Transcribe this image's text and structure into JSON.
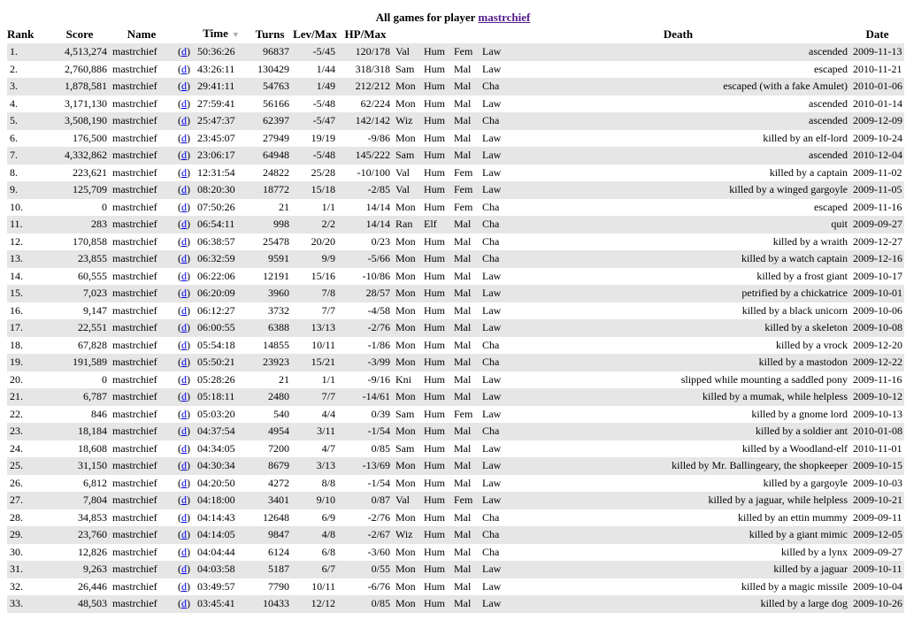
{
  "caption": {
    "prefix": "All games for player",
    "player_link": "mastrchief"
  },
  "sort_arrow": "▼",
  "columns": [
    "Rank",
    "Score",
    "Name",
    "",
    "Time",
    "Turns",
    "Lev/Max",
    "HP/Max",
    "",
    "",
    "",
    "",
    "Death",
    "Date"
  ],
  "dump_label": "d",
  "rows": [
    [
      "1.",
      "4,513,274",
      "mastrchief",
      "50:36:26",
      "96837",
      "-5/45",
      "120/178",
      "Val",
      "Hum",
      "Fem",
      "Law",
      "ascended",
      "2009-11-13"
    ],
    [
      "2.",
      "2,760,886",
      "mastrchief",
      "43:26:11",
      "130429",
      "1/44",
      "318/318",
      "Sam",
      "Hum",
      "Mal",
      "Law",
      "escaped",
      "2010-11-21"
    ],
    [
      "3.",
      "1,878,581",
      "mastrchief",
      "29:41:11",
      "54763",
      "1/49",
      "212/212",
      "Mon",
      "Hum",
      "Mal",
      "Cha",
      "escaped (with a fake Amulet)",
      "2010-01-06"
    ],
    [
      "4.",
      "3,171,130",
      "mastrchief",
      "27:59:41",
      "56166",
      "-5/48",
      "62/224",
      "Mon",
      "Hum",
      "Mal",
      "Law",
      "ascended",
      "2010-01-14"
    ],
    [
      "5.",
      "3,508,190",
      "mastrchief",
      "25:47:37",
      "62397",
      "-5/47",
      "142/142",
      "Wiz",
      "Hum",
      "Mal",
      "Cha",
      "ascended",
      "2009-12-09"
    ],
    [
      "6.",
      "176,500",
      "mastrchief",
      "23:45:07",
      "27949",
      "19/19",
      "-9/86",
      "Mon",
      "Hum",
      "Mal",
      "Law",
      "killed by an elf-lord",
      "2009-10-24"
    ],
    [
      "7.",
      "4,332,862",
      "mastrchief",
      "23:06:17",
      "64948",
      "-5/48",
      "145/222",
      "Sam",
      "Hum",
      "Mal",
      "Law",
      "ascended",
      "2010-12-04"
    ],
    [
      "8.",
      "223,621",
      "mastrchief",
      "12:31:54",
      "24822",
      "25/28",
      "-10/100",
      "Val",
      "Hum",
      "Fem",
      "Law",
      "killed by a captain",
      "2009-11-02"
    ],
    [
      "9.",
      "125,709",
      "mastrchief",
      "08:20:30",
      "18772",
      "15/18",
      "-2/85",
      "Val",
      "Hum",
      "Fem",
      "Law",
      "killed by a winged gargoyle",
      "2009-11-05"
    ],
    [
      "10.",
      "0",
      "mastrchief",
      "07:50:26",
      "21",
      "1/1",
      "14/14",
      "Mon",
      "Hum",
      "Fem",
      "Cha",
      "escaped",
      "2009-11-16"
    ],
    [
      "11.",
      "283",
      "mastrchief",
      "06:54:11",
      "998",
      "2/2",
      "14/14",
      "Ran",
      "Elf",
      "Mal",
      "Cha",
      "quit",
      "2009-09-27"
    ],
    [
      "12.",
      "170,858",
      "mastrchief",
      "06:38:57",
      "25478",
      "20/20",
      "0/23",
      "Mon",
      "Hum",
      "Mal",
      "Cha",
      "killed by a wraith",
      "2009-12-27"
    ],
    [
      "13.",
      "23,855",
      "mastrchief",
      "06:32:59",
      "9591",
      "9/9",
      "-5/66",
      "Mon",
      "Hum",
      "Mal",
      "Cha",
      "killed by a watch captain",
      "2009-12-16"
    ],
    [
      "14.",
      "60,555",
      "mastrchief",
      "06:22:06",
      "12191",
      "15/16",
      "-10/86",
      "Mon",
      "Hum",
      "Mal",
      "Law",
      "killed by a frost giant",
      "2009-10-17"
    ],
    [
      "15.",
      "7,023",
      "mastrchief",
      "06:20:09",
      "3960",
      "7/8",
      "28/57",
      "Mon",
      "Hum",
      "Mal",
      "Law",
      "petrified by a chickatrice",
      "2009-10-01"
    ],
    [
      "16.",
      "9,147",
      "mastrchief",
      "06:12:27",
      "3732",
      "7/7",
      "-4/58",
      "Mon",
      "Hum",
      "Mal",
      "Law",
      "killed by a black unicorn",
      "2009-10-06"
    ],
    [
      "17.",
      "22,551",
      "mastrchief",
      "06:00:55",
      "6388",
      "13/13",
      "-2/76",
      "Mon",
      "Hum",
      "Mal",
      "Law",
      "killed by a skeleton",
      "2009-10-08"
    ],
    [
      "18.",
      "67,828",
      "mastrchief",
      "05:54:18",
      "14855",
      "10/11",
      "-1/86",
      "Mon",
      "Hum",
      "Mal",
      "Cha",
      "killed by a vrock",
      "2009-12-20"
    ],
    [
      "19.",
      "191,589",
      "mastrchief",
      "05:50:21",
      "23923",
      "15/21",
      "-3/99",
      "Mon",
      "Hum",
      "Mal",
      "Cha",
      "killed by a mastodon",
      "2009-12-22"
    ],
    [
      "20.",
      "0",
      "mastrchief",
      "05:28:26",
      "21",
      "1/1",
      "-9/16",
      "Kni",
      "Hum",
      "Mal",
      "Law",
      "slipped while mounting a saddled pony",
      "2009-11-16"
    ],
    [
      "21.",
      "6,787",
      "mastrchief",
      "05:18:11",
      "2480",
      "7/7",
      "-14/61",
      "Mon",
      "Hum",
      "Mal",
      "Law",
      "killed by a mumak, while helpless",
      "2009-10-12"
    ],
    [
      "22.",
      "846",
      "mastrchief",
      "05:03:20",
      "540",
      "4/4",
      "0/39",
      "Sam",
      "Hum",
      "Fem",
      "Law",
      "killed by a gnome lord",
      "2009-10-13"
    ],
    [
      "23.",
      "18,184",
      "mastrchief",
      "04:37:54",
      "4954",
      "3/11",
      "-1/54",
      "Mon",
      "Hum",
      "Mal",
      "Cha",
      "killed by a soldier ant",
      "2010-01-08"
    ],
    [
      "24.",
      "18,608",
      "mastrchief",
      "04:34:05",
      "7200",
      "4/7",
      "0/85",
      "Sam",
      "Hum",
      "Mal",
      "Law",
      "killed by a Woodland-elf",
      "2010-11-01"
    ],
    [
      "25.",
      "31,150",
      "mastrchief",
      "04:30:34",
      "8679",
      "3/13",
      "-13/69",
      "Mon",
      "Hum",
      "Mal",
      "Law",
      "killed by Mr. Ballingeary, the shopkeeper",
      "2009-10-15"
    ],
    [
      "26.",
      "6,812",
      "mastrchief",
      "04:20:50",
      "4272",
      "8/8",
      "-1/54",
      "Mon",
      "Hum",
      "Mal",
      "Law",
      "killed by a gargoyle",
      "2009-10-03"
    ],
    [
      "27.",
      "7,804",
      "mastrchief",
      "04:18:00",
      "3401",
      "9/10",
      "0/87",
      "Val",
      "Hum",
      "Fem",
      "Law",
      "killed by a jaguar, while helpless",
      "2009-10-21"
    ],
    [
      "28.",
      "34,853",
      "mastrchief",
      "04:14:43",
      "12648",
      "6/9",
      "-2/76",
      "Mon",
      "Hum",
      "Mal",
      "Cha",
      "killed by an ettin mummy",
      "2009-09-11"
    ],
    [
      "29.",
      "23,760",
      "mastrchief",
      "04:14:05",
      "9847",
      "4/8",
      "-2/67",
      "Wiz",
      "Hum",
      "Mal",
      "Cha",
      "killed by a giant mimic",
      "2009-12-05"
    ],
    [
      "30.",
      "12,826",
      "mastrchief",
      "04:04:44",
      "6124",
      "6/8",
      "-3/60",
      "Mon",
      "Hum",
      "Mal",
      "Cha",
      "killed by a lynx",
      "2009-09-27"
    ],
    [
      "31.",
      "9,263",
      "mastrchief",
      "04:03:58",
      "5187",
      "6/7",
      "0/55",
      "Mon",
      "Hum",
      "Mal",
      "Law",
      "killed by a jaguar",
      "2009-10-11"
    ],
    [
      "32.",
      "26,446",
      "mastrchief",
      "03:49:57",
      "7790",
      "10/11",
      "-6/76",
      "Mon",
      "Hum",
      "Mal",
      "Law",
      "killed by a magic missile",
      "2009-10-04"
    ],
    [
      "33.",
      "48,503",
      "mastrchief",
      "03:45:41",
      "10433",
      "12/12",
      "0/85",
      "Mon",
      "Hum",
      "Mal",
      "Law",
      "killed by a large dog",
      "2009-10-26"
    ]
  ]
}
